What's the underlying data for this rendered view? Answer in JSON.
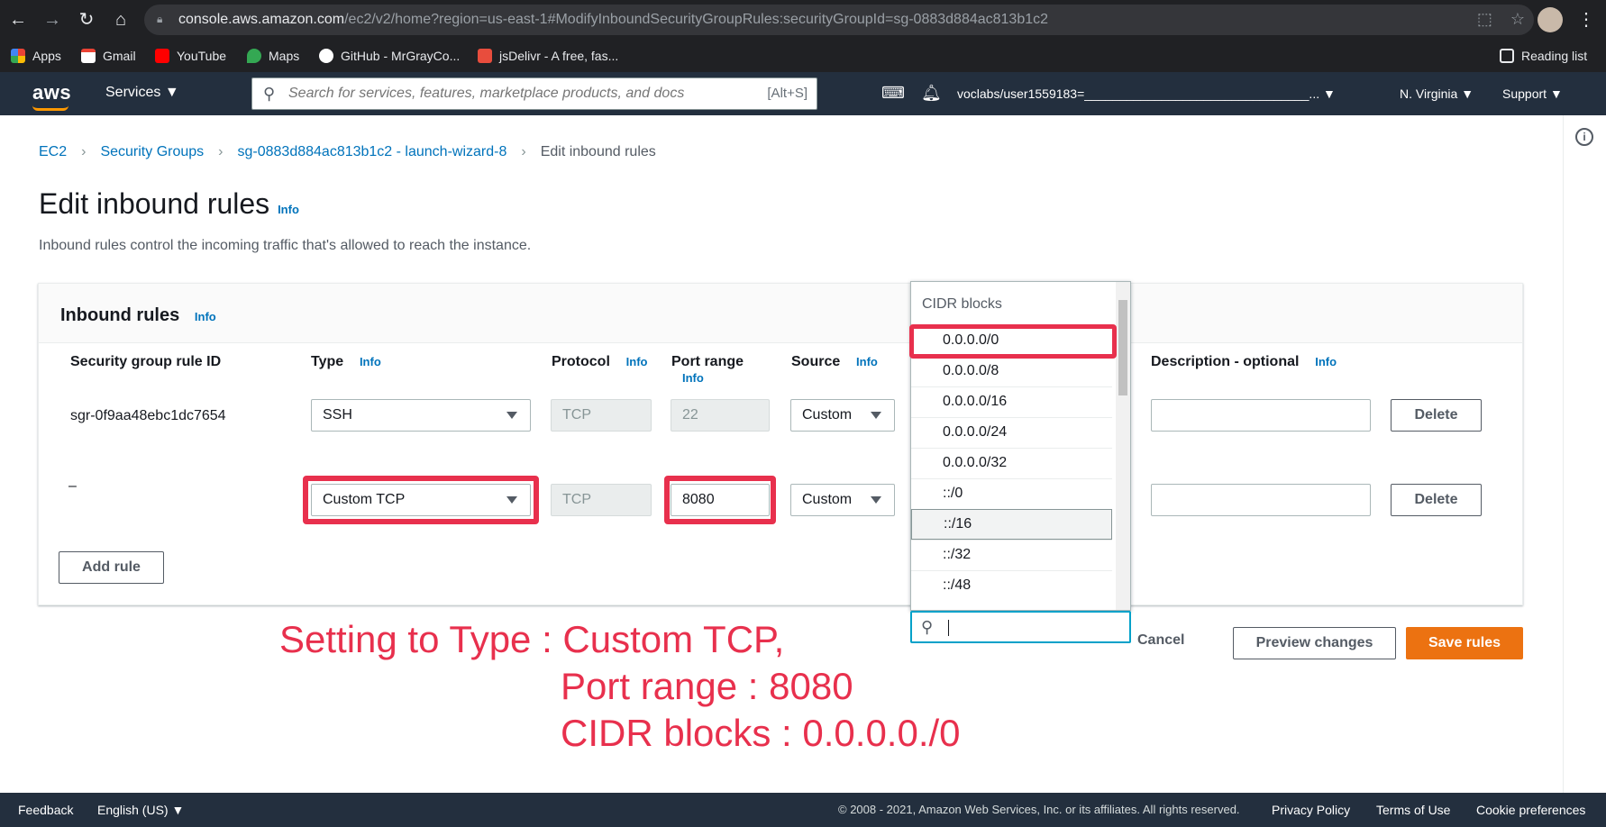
{
  "browser": {
    "url_host": "console.aws.amazon.com",
    "url_path": "/ec2/v2/home?region=us-east-1#ModifyInboundSecurityGroupRules:securityGroupId=sg-0883d884ac813b1c2",
    "bookmarks": [
      "Apps",
      "Gmail",
      "YouTube",
      "Maps",
      "GitHub - MrGrayCo...",
      "jsDelivr - A free, fas..."
    ],
    "reading_list": "Reading list"
  },
  "aws_header": {
    "logo": "aws",
    "services": "Services",
    "search_placeholder": "Search for services, features, marketplace products, and docs",
    "search_shortcut": "[Alt+S]",
    "account": "voclabs/user1559183=________________________________...",
    "region": "N. Virginia",
    "support": "Support"
  },
  "breadcrumb": [
    "EC2",
    "Security Groups",
    "sg-0883d884ac813b1c2 - launch-wizard-8",
    "Edit inbound rules"
  ],
  "page": {
    "title": "Edit inbound rules",
    "info": "Info",
    "description": "Inbound rules control the incoming traffic that's allowed to reach the instance."
  },
  "panel": {
    "title": "Inbound rules",
    "info": "Info",
    "columns": {
      "rule_id": "Security group rule ID",
      "type": "Type",
      "protocol": "Protocol",
      "port_range": "Port range",
      "source": "Source",
      "description": "Description - optional"
    },
    "rows": [
      {
        "rule_id": "sgr-0f9aa48ebc1dc7654",
        "type": "SSH",
        "protocol": "TCP",
        "port": "22",
        "source": "Custom",
        "delete": "Delete"
      },
      {
        "rule_id": "–",
        "type": "Custom TCP",
        "protocol": "TCP",
        "port": "8080",
        "source": "Custom",
        "delete": "Delete"
      }
    ],
    "add_rule": "Add rule"
  },
  "cidr_dropdown": {
    "header": "CIDR blocks",
    "items": [
      "0.0.0.0/0",
      "0.0.0.0/8",
      "0.0.0.0/16",
      "0.0.0.0/24",
      "0.0.0.0/32",
      "::/0",
      "::/16",
      "::/32",
      "::/48"
    ]
  },
  "actions": {
    "cancel": "Cancel",
    "preview": "Preview changes",
    "save": "Save rules"
  },
  "annotation": {
    "line1": "Setting to Type : Custom TCP,",
    "line2": "Port range : 8080",
    "line3": "CIDR blocks : 0.0.0.0./0"
  },
  "footer": {
    "feedback": "Feedback",
    "language": "English (US)",
    "copyright": "© 2008 - 2021, Amazon Web Services, Inc. or its affiliates. All rights reserved.",
    "privacy": "Privacy Policy",
    "terms": "Terms of Use",
    "cookies": "Cookie preferences"
  },
  "colors": {
    "aws_nav": "#232f3e",
    "link": "#0073bb",
    "primary": "#ec7211",
    "highlight": "#e8304d"
  }
}
